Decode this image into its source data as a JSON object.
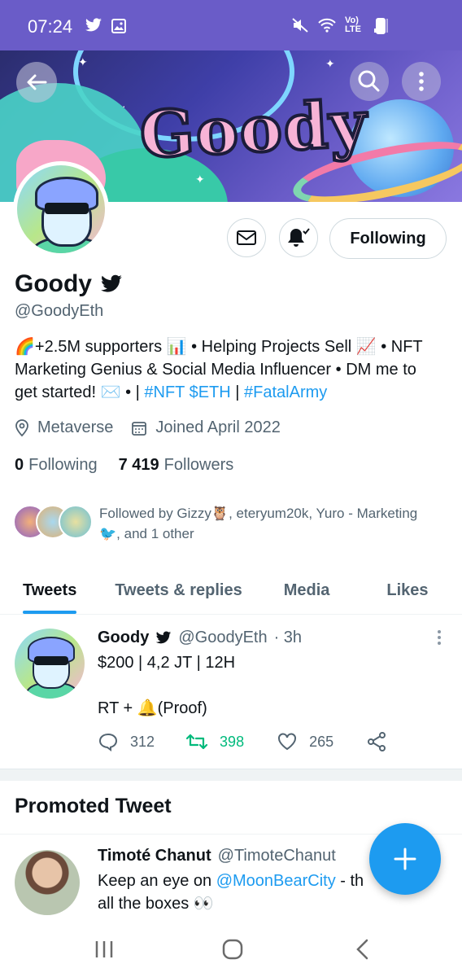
{
  "status_bar": {
    "time": "07:24",
    "network": "Vo) LTE"
  },
  "profile": {
    "name": "Goody",
    "handle": "@GoodyEth",
    "banner_text": "Goody",
    "bio_line1": "🌈+2.5M supporters 📊 • Helping Projects Sell 📈 • NFT",
    "bio_line2": "Marketing Genius & Social Media Influencer • DM me to",
    "bio_line3_prefix": "get started! ✉️ • | ",
    "bio_link1": "#NFT",
    "bio_link2": "$ETH",
    "bio_sep": " | ",
    "bio_link3": "#FatalArmy",
    "location": "Metaverse",
    "joined": "Joined April 2022",
    "following_count": "0",
    "following_label": "Following",
    "followers_count": "7 419",
    "followers_label": "Followers",
    "followed_by_line1": "Followed by Gizzy🦉, eteryum20k, Yuro - Marketing",
    "followed_by_line2": "🐦, and 1 other",
    "follow_button_label": "Following"
  },
  "tabs": [
    {
      "label": "Tweets",
      "active": true
    },
    {
      "label": "Tweets & replies",
      "active": false
    },
    {
      "label": "Media",
      "active": false
    },
    {
      "label": "Likes",
      "active": false
    }
  ],
  "tweet": {
    "name": "Goody",
    "handle": "@GoodyEth",
    "time": "· 3h",
    "line1": "$200 | 4,2 JT | 12H",
    "line2": "RT + 🔔(Proof)",
    "replies": "312",
    "retweets": "398",
    "likes": "265"
  },
  "promoted": {
    "title": "Promoted Tweet",
    "name": "Timoté Chanut",
    "handle": "@TimoteChanut",
    "text_prefix": "Keep an eye on ",
    "text_link": "@MoonBearCity",
    "text_suffix": " - th",
    "line2": "all the boxes 👀"
  },
  "colors": {
    "accent": "#1d9bf0",
    "retweet": "#00ba7c",
    "status_bar": "#6a5cc8",
    "muted": "#536471"
  }
}
